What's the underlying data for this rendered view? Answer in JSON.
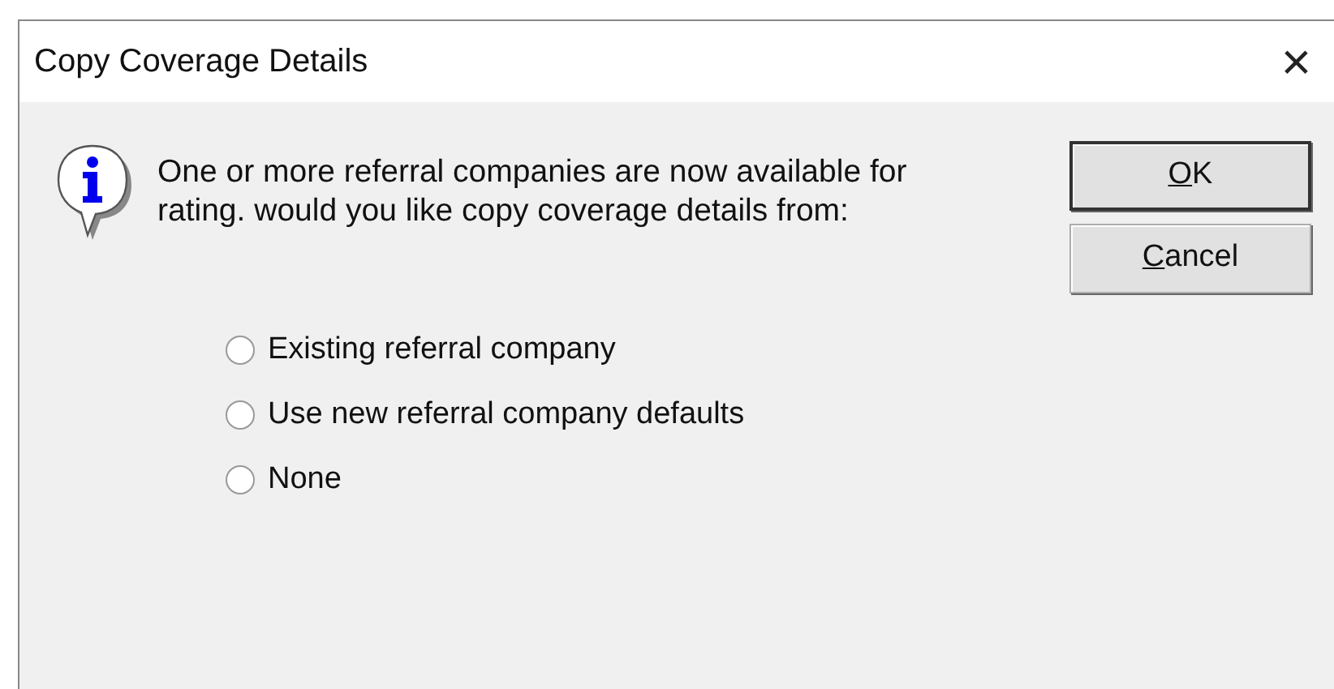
{
  "window": {
    "title": "Copy Coverage Details",
    "close_label": "×"
  },
  "message": "One or more referral companies are now available for rating. would you like copy coverage details from:",
  "options": [
    {
      "label": "Existing referral company",
      "selected": false
    },
    {
      "label": "Use new referral company defaults",
      "selected": false
    },
    {
      "label": "None",
      "selected": false
    }
  ],
  "buttons": [
    {
      "mnemonic": "O",
      "rest": "K",
      "default": true
    },
    {
      "mnemonic": "C",
      "rest": "ancel",
      "default": false
    }
  ]
}
